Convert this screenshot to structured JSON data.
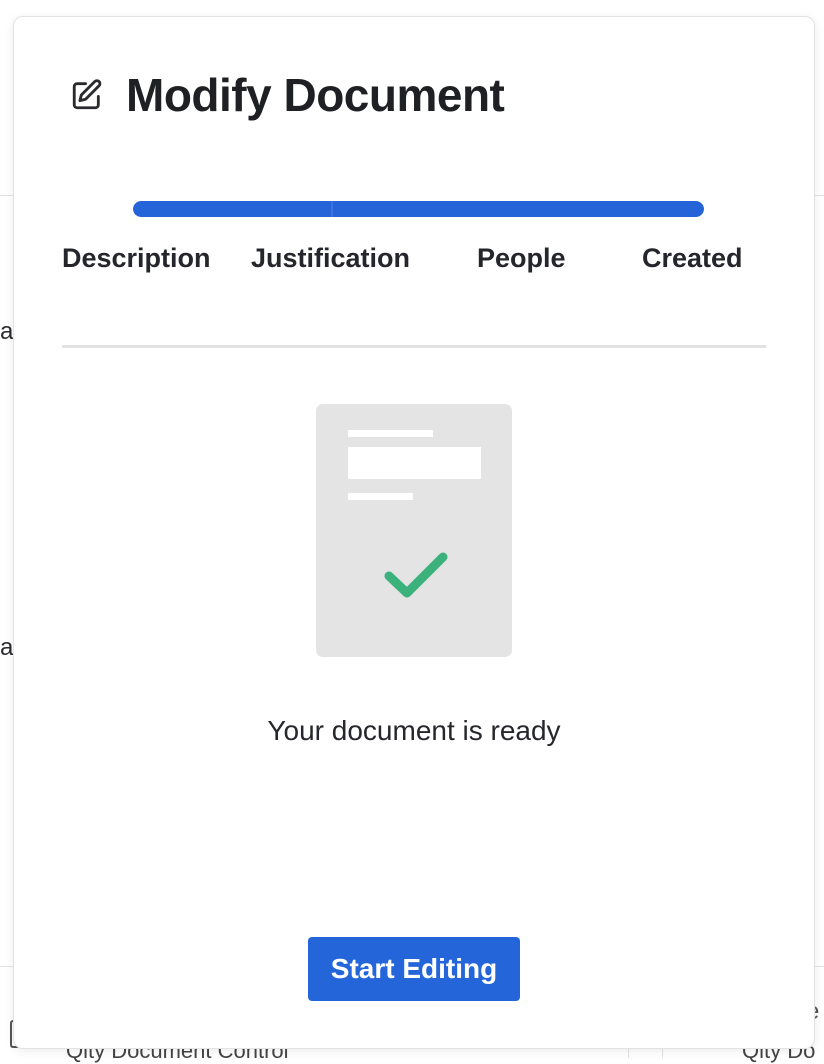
{
  "background": {
    "fragment_a1": "a",
    "fragment_a2": "a",
    "fragment_e": "e",
    "footer_left": "Qity Document Control",
    "footer_right": "Qity Do"
  },
  "modal": {
    "title": "Modify Document",
    "title_icon": "edit-icon",
    "progress_percent": 100,
    "steps": [
      {
        "label": "Description"
      },
      {
        "label": "Justification"
      },
      {
        "label": "People"
      },
      {
        "label": "Created"
      }
    ],
    "illustration_icon": "document-check-icon",
    "status_text": "Your document is ready",
    "start_button_label": "Start Editing"
  },
  "colors": {
    "accent": "#2563d9",
    "check": "#3bb27c",
    "doc_bg": "#e4e4e4"
  }
}
